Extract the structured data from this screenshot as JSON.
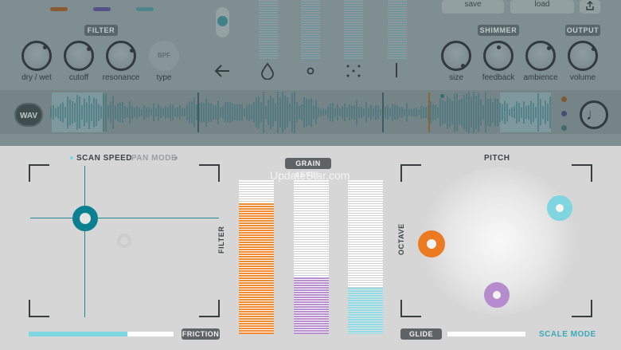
{
  "top": {
    "buttons": {
      "save": "save",
      "load": "load"
    },
    "filter": {
      "section_label": "FILTER",
      "knobs": [
        {
          "name": "dry-wet",
          "label": "dry / wet"
        },
        {
          "name": "cutoff",
          "label": "cutoff"
        },
        {
          "name": "resonance",
          "label": "resonance"
        }
      ],
      "type_value": "BPF",
      "type_label": "type"
    },
    "shimmer": {
      "section_label": "SHIMMER",
      "knobs": [
        {
          "name": "size",
          "label": "size"
        },
        {
          "name": "feedback",
          "label": "feedback"
        },
        {
          "name": "ambience",
          "label": "ambience"
        }
      ]
    },
    "output": {
      "section_label": "OUTPUT",
      "knob_label": "volume"
    },
    "icons": [
      "back-arrow-icon",
      "drop-icon",
      "dot-icon",
      "scatter-icon",
      "line-icon"
    ]
  },
  "waveform": {
    "wav_label": "WAV",
    "note_glyph": "♩",
    "dot_colors": [
      "#8a5a2a",
      "#444b7a",
      "#3c6f76"
    ]
  },
  "scan": {
    "scan_speed_label": "SCAN SPEED",
    "pan_mode_label": "PAN MODE",
    "friction_label": "FRICTION",
    "friction_level": 0.68,
    "accent": "#0a8090"
  },
  "grain": {
    "section_label": "GRAIN LEVEL",
    "filter_label": "FILTER",
    "watermark": "UpdateStar.com",
    "bars": [
      {
        "name": "grain-bar-orange",
        "level": 0.85,
        "color": "#f08a33"
      },
      {
        "name": "grain-bar-purple",
        "level": 0.37,
        "color": "#b98fcf"
      },
      {
        "name": "grain-bar-cyan",
        "level": 0.3,
        "color": "#8fdde6"
      }
    ]
  },
  "pitch": {
    "section_label": "PITCH",
    "octave_label": "OCTAVE",
    "glide_label": "GLIDE",
    "glide_level": 0.0,
    "scale_mode_label": "SCALE MODE",
    "colors": {
      "orange": "#ec7a22",
      "cyan": "#7fd6e0",
      "purple": "#b68ccf",
      "scale_mode_text": "#3aaab8"
    }
  }
}
